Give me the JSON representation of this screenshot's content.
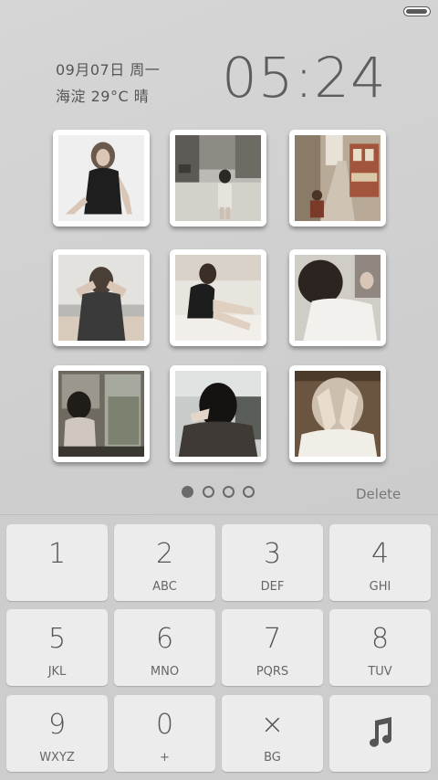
{
  "status_bar": {
    "battery_level": 1.0
  },
  "lock": {
    "date": "09月07日  周一",
    "weather": "海淀  29°C  晴",
    "time": "05:24"
  },
  "photos": [
    {
      "name": "photo-girl-dark-dress"
    },
    {
      "name": "photo-street-girl"
    },
    {
      "name": "photo-tram-street"
    },
    {
      "name": "photo-beach-girl"
    },
    {
      "name": "photo-sitting-girl"
    },
    {
      "name": "photo-girl-reading"
    },
    {
      "name": "photo-train-window"
    },
    {
      "name": "photo-back-of-head"
    },
    {
      "name": "photo-hands-face"
    }
  ],
  "pager": {
    "page_count": 4,
    "current_page": 1
  },
  "delete_label": "Delete",
  "keypad": {
    "keys": [
      {
        "digit": "1",
        "letters": ""
      },
      {
        "digit": "2",
        "letters": "ABC"
      },
      {
        "digit": "3",
        "letters": "DEF"
      },
      {
        "digit": "4",
        "letters": "GHI"
      },
      {
        "digit": "5",
        "letters": "JKL"
      },
      {
        "digit": "6",
        "letters": "MNO"
      },
      {
        "digit": "7",
        "letters": "PQRS"
      },
      {
        "digit": "8",
        "letters": "TUV"
      },
      {
        "digit": "9",
        "letters": "WXYZ"
      },
      {
        "digit": "0",
        "letters": "+"
      },
      {
        "digit": "×",
        "letters": "BG"
      },
      {
        "digit": "",
        "letters": "",
        "icon": "music-note-icon"
      }
    ]
  }
}
